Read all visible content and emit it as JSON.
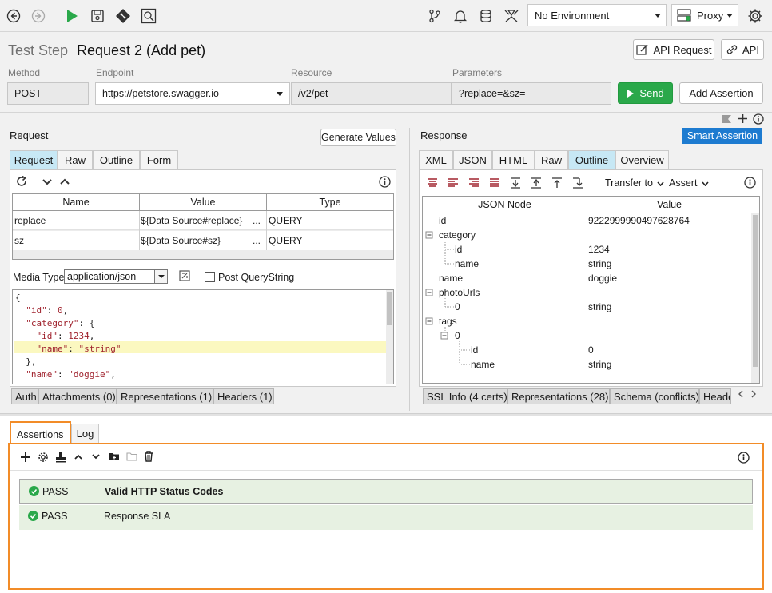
{
  "toolbar": {
    "environment": "No Environment",
    "proxy": "Proxy"
  },
  "header": {
    "prefix": "Test Step",
    "title": "Request 2 (Add pet)",
    "api_request_btn": "API Request",
    "api_btn": "API"
  },
  "fields": {
    "method_label": "Method",
    "method": "POST",
    "endpoint_label": "Endpoint",
    "endpoint": "https://petstore.swagger.io",
    "resource_label": "Resource",
    "resource": "/v2/pet",
    "parameters_label": "Parameters",
    "parameters": "?replace=&sz=",
    "send": "Send",
    "add_assertion": "Add Assertion"
  },
  "request": {
    "title": "Request",
    "generate_values": "Generate Values",
    "tabs": [
      "Request",
      "Raw",
      "Outline",
      "Form"
    ],
    "columns": [
      "Name",
      "Value",
      "Type"
    ],
    "rows": [
      {
        "name": "replace",
        "value": "${Data Source#replace}",
        "more": "...",
        "type": "QUERY"
      },
      {
        "name": "sz",
        "value": "${Data Source#sz}",
        "more": "...",
        "type": "QUERY"
      }
    ],
    "media_type_label": "Media Type",
    "media_type": "application/json",
    "post_querystring": "Post QueryString",
    "bottom_tabs": [
      "Auth",
      "Attachments (0)",
      "Representations (1)",
      "Headers (1)"
    ]
  },
  "response": {
    "title": "Response",
    "smart_assertion": "Smart Assertion",
    "tabs": [
      "XML",
      "JSON",
      "HTML",
      "Raw",
      "Outline",
      "Overview"
    ],
    "transfer_to": "Transfer to",
    "assert": "Assert",
    "columns": [
      "JSON Node",
      "Value"
    ],
    "tree": [
      {
        "node": "id",
        "value": "9222999990497628764"
      },
      {
        "node": "category",
        "value": ""
      },
      {
        "node": "id",
        "value": "1234"
      },
      {
        "node": "name",
        "value": "string"
      },
      {
        "node": "name",
        "value": "doggie"
      },
      {
        "node": "photoUrls",
        "value": ""
      },
      {
        "node": "0",
        "value": "string"
      },
      {
        "node": "tags",
        "value": ""
      },
      {
        "node": "0",
        "value": ""
      },
      {
        "node": "id",
        "value": "0"
      },
      {
        "node": "name",
        "value": "string"
      }
    ],
    "bottom_tabs": [
      "SSL Info (4 certs)",
      "Representations (28)",
      "Schema (conflicts)",
      "Heade"
    ]
  },
  "assertions": {
    "tabs": [
      "Assertions",
      "Log"
    ],
    "items": [
      {
        "status": "PASS",
        "name": "Valid HTTP Status Codes"
      },
      {
        "status": "PASS",
        "name": "Response SLA"
      }
    ]
  },
  "colors": {
    "accent_green": "#2aa84a",
    "smart_blue": "#1d7bd0",
    "highlight_orange": "#f28c28",
    "tab_active": "#c7e8f5"
  }
}
